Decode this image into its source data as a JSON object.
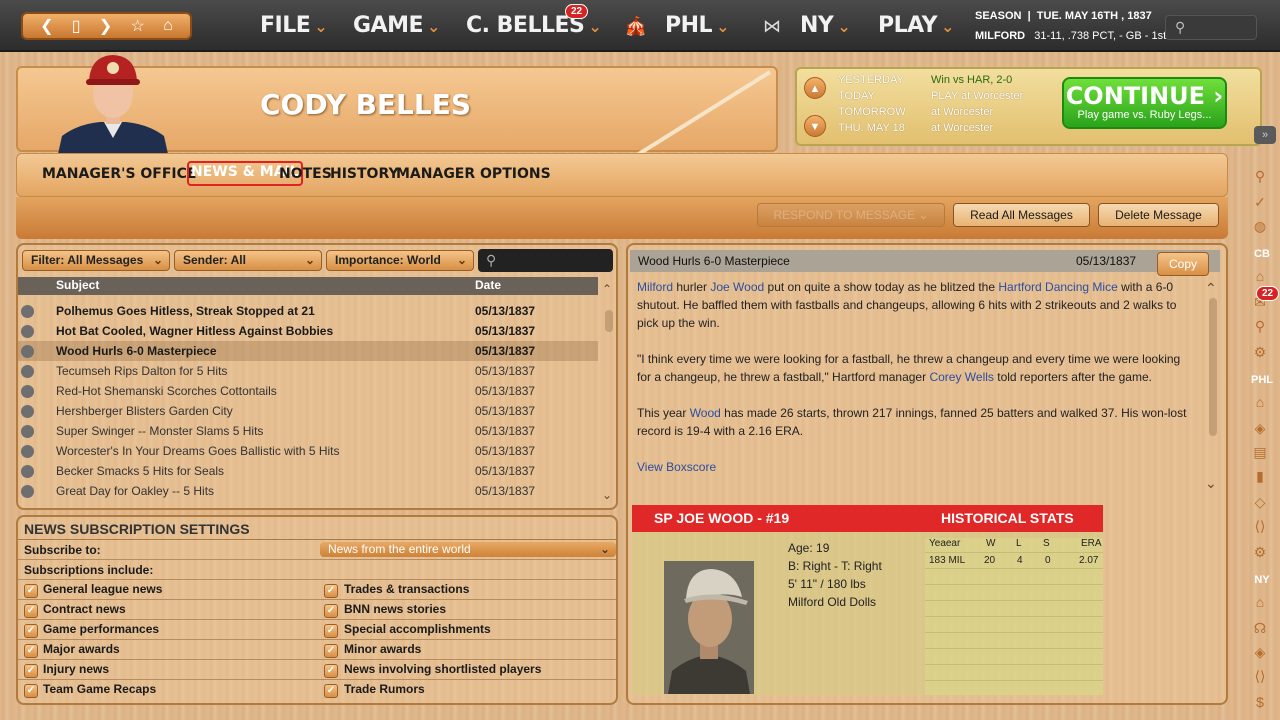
{
  "topbar": {
    "menus": [
      {
        "label": "FILE"
      },
      {
        "label": "GAME"
      },
      {
        "label": "C. BELLES",
        "badge": "22"
      },
      {
        "label": "PHL"
      },
      {
        "label": "NY"
      },
      {
        "label": "PLAY"
      }
    ],
    "season_label": "SEASON",
    "season_date": "TUE. MAY 16TH , 1837",
    "team": "MILFORD",
    "record": "31-11, .738 PCT, - GB - 1st"
  },
  "player": {
    "name": "CODY BELLES"
  },
  "schedule": [
    {
      "label": "YESTERDAY",
      "value": "Win vs HAR, 2-0"
    },
    {
      "label": "TODAY",
      "value": "PLAY at Worcester"
    },
    {
      "label": "TOMORROW",
      "value": "at Worcester"
    },
    {
      "label": "THU. MAY 18",
      "value": "at Worcester"
    }
  ],
  "continue": {
    "label": "CONTINUE",
    "sub": "Play game vs. Ruby Legs..."
  },
  "tabs": [
    "MANAGER'S OFFICE",
    "NEWS & MAIL",
    "NOTES",
    "HISTORY",
    "MANAGER OPTIONS"
  ],
  "actions": {
    "respond": "RESPOND TO MESSAGE",
    "read_all": "Read All Messages",
    "delete": "Delete Message"
  },
  "filters": {
    "filter": "Filter: All Messages",
    "sender": "Sender: All",
    "importance": "Importance: World"
  },
  "list": {
    "col_subject": "Subject",
    "col_date": "Date",
    "rows": [
      {
        "subject": "Polhemus Goes Hitless, Streak Stopped at 21",
        "date": "05/13/1837"
      },
      {
        "subject": "Hot Bat Cooled, Wagner Hitless Against Bobbies",
        "date": "05/13/1837"
      },
      {
        "subject": "Wood Hurls 6-0 Masterpiece",
        "date": "05/13/1837"
      },
      {
        "subject": "Tecumseh Rips Dalton for 5 Hits",
        "date": "05/13/1837"
      },
      {
        "subject": "Red-Hot Shemanski Scorches Cottontails",
        "date": "05/13/1837"
      },
      {
        "subject": "Hershberger Blisters Garden City",
        "date": "05/13/1837"
      },
      {
        "subject": "Super Swinger -- Monster Slams 5 Hits",
        "date": "05/13/1837"
      },
      {
        "subject": "Worcester's In Your Dreams Goes Ballistic with 5 Hits",
        "date": "05/13/1837"
      },
      {
        "subject": "Becker Smacks 5 Hits for Seals",
        "date": "05/13/1837"
      },
      {
        "subject": "Great Day for Oakley -- 5 Hits",
        "date": "05/13/1837"
      }
    ]
  },
  "subscriptions": {
    "title": "NEWS SUBSCRIPTION SETTINGS",
    "subscribe_label": "Subscribe to:",
    "subscribe_value": "News from the entire world",
    "include_label": "Subscriptions include:",
    "left": [
      "General league news",
      "Contract news",
      "Game performances",
      "Major awards",
      "Injury news",
      "Team Game Recaps"
    ],
    "right": [
      "Trades & transactions",
      "BNN news stories",
      "Special accomplishments",
      "Minor awards",
      "News involving shortlisted players",
      "Trade Rumors"
    ]
  },
  "message": {
    "title": "Wood Hurls 6-0 Masterpiece",
    "date": "05/13/1837",
    "copy": "Copy",
    "p1": [
      {
        "t": "Milford",
        "link": true
      },
      {
        "t": " hurler "
      },
      {
        "t": "Joe Wood",
        "link": true
      },
      {
        "t": " put on quite a show today as he blitzed the "
      },
      {
        "t": "Hartford Dancing Mice",
        "link": true
      },
      {
        "t": " with a 6-0 shutout. He baffled them with fastballs and changeups, allowing 6 hits with 2 strikeouts and 2 walks to pick up the win."
      }
    ],
    "p2": [
      {
        "t": "\"I think every time we were looking for a fastball, he threw a changeup and every time we were looking for a changeup, he threw a fastball,\" Hartford manager "
      },
      {
        "t": "Corey Wells",
        "link": true
      },
      {
        "t": " told reporters after the game."
      }
    ],
    "p3": [
      {
        "t": "This year "
      },
      {
        "t": "Wood",
        "link": true
      },
      {
        "t": " has made 26 starts, thrown 217 innings, fanned 25 batters and walked 37. His won-lost record is 19-4 with a 2.16 ERA."
      }
    ],
    "boxscore": "View Boxscore"
  },
  "card": {
    "title": "SP JOE WOOD - #19",
    "stats_title": "HISTORICAL STATS",
    "age": "Age: 19",
    "bt": "B: Right - T: Right",
    "size": "5' 11\" / 180 lbs",
    "team": "Milford Old Dolls",
    "stat_headers": [
      "Yeaear",
      "W",
      "L",
      "S",
      "ERA"
    ],
    "stat_row": [
      "183 MIL",
      "20",
      "4",
      "0",
      "2.07"
    ]
  },
  "sidebar": {
    "labels": [
      "CB",
      "PHL",
      "NY"
    ],
    "badge": "22"
  }
}
